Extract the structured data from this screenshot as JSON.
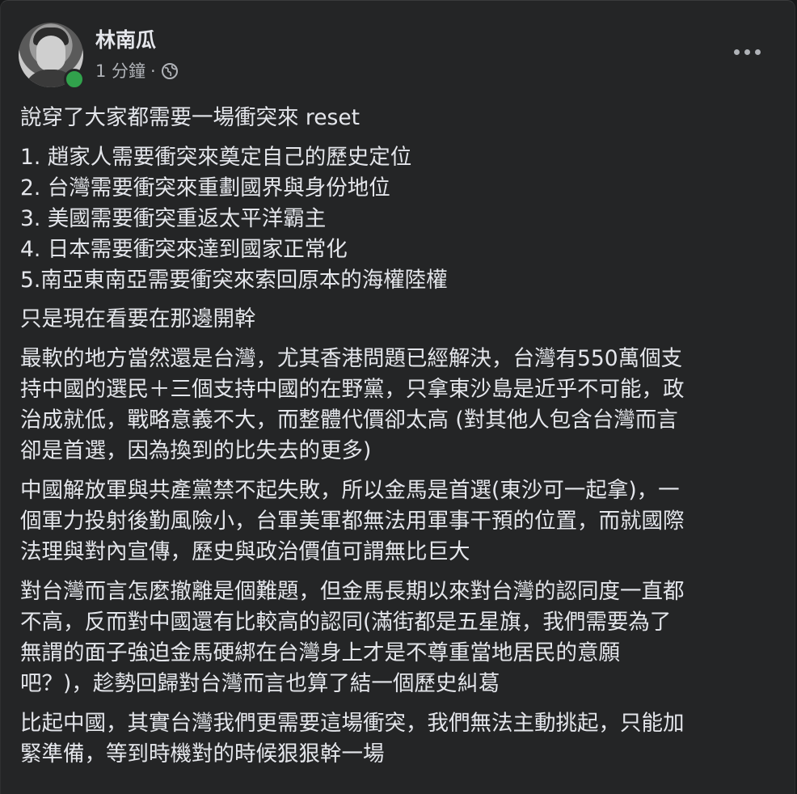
{
  "post": {
    "author": "林南瓜",
    "time": "1 分鐘",
    "separator": "·",
    "privacy_icon": "globe-icon",
    "more_icon": "more-options-icon",
    "paragraphs": [
      {
        "lines": [
          "說穿了大家都需要一場衝突來 reset"
        ]
      },
      {
        "lines": [
          "1. 趙家人需要衝突來奠定自己的歷史定位",
          "2. 台灣需要衝突來重劃國界與身份地位",
          "3. 美國需要衝突重返太平洋霸主",
          "4. 日本需要衝突來達到國家正常化",
          "5.南亞東南亞需要衝突來索回原本的海權陸權"
        ]
      },
      {
        "lines": [
          "只是現在看要在那邊開幹"
        ]
      },
      {
        "lines": [
          "最軟的地方當然還是台灣，尤其香港問題已經解決，台灣有550萬個支",
          "持中國的選民＋三個支持中國的在野黨，只拿東沙島是近乎不可能，政",
          "治成就低，戰略意義不大，而整體代價卻太高 (對其他人包含台灣而言",
          "卻是首選，因為換到的比失去的更多)"
        ]
      },
      {
        "lines": [
          "中國解放軍與共產黨禁不起失敗，所以金馬是首選(東沙可一起拿)，一",
          "個軍力投射後勤風險小，台軍美軍都無法用軍事干預的位置，而就國際",
          "法理與對內宣傳，歷史與政治價值可謂無比巨大"
        ]
      },
      {
        "lines": [
          "對台灣而言怎麼撤離是個難題，但金馬長期以來對台灣的認同度一直都",
          "不高，反而對中國還有比較高的認同(滿街都是五星旗，我們需要為了",
          "無謂的面子強迫金馬硬綁在台灣身上才是不尊重當地居民的意願",
          "吧？)，趁勢回歸對台灣而言也算了結一個歷史糾葛"
        ]
      },
      {
        "lines": [
          "比起中國，其實台灣我們更需要這場衝突，我們無法主動挑起，只能加",
          "緊準備，等到時機對的時候狠狠幹一場"
        ]
      }
    ]
  }
}
